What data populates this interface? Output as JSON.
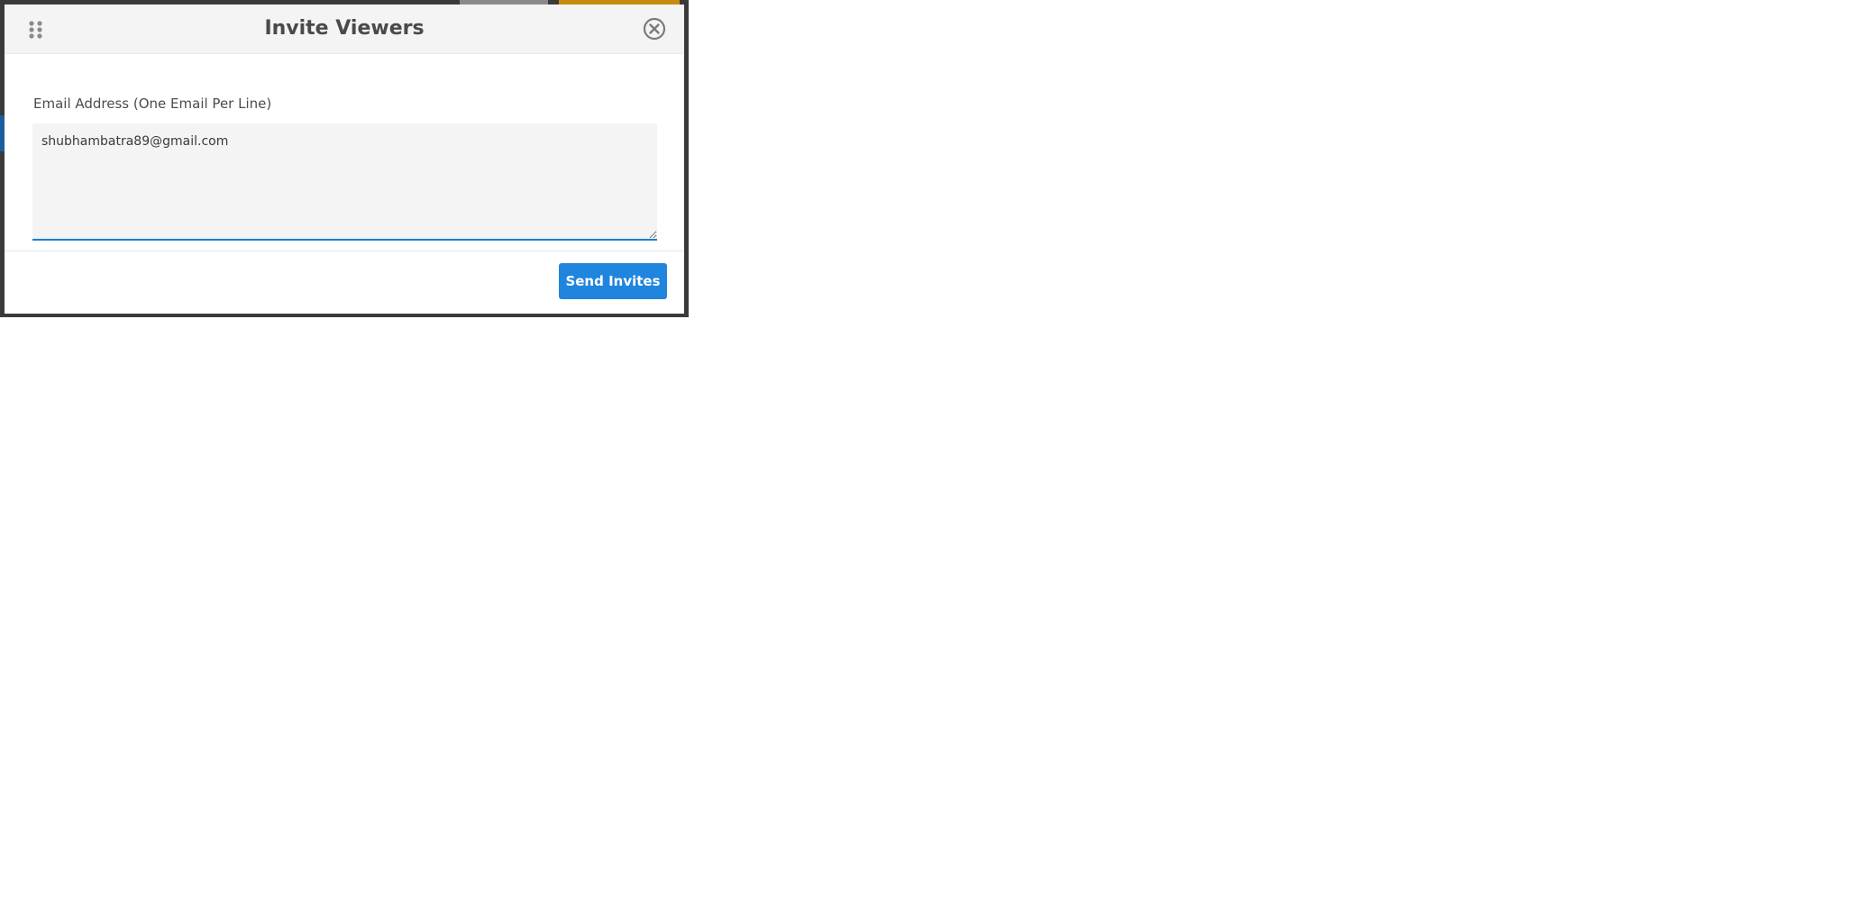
{
  "modal": {
    "title": "Invite Viewers",
    "drag_icon": "drag-handle-icon",
    "close_icon": "close-circle-icon"
  },
  "form": {
    "email_label": "Email Address (One Email Per Line)",
    "email_value": "shubhambatra89@gmail.com"
  },
  "footer": {
    "send_label": "Send Invites"
  },
  "colors": {
    "primary": "#1f85de",
    "header_bg": "#f4f4f4",
    "textarea_bg": "#f4f4f4",
    "focus_border": "#1f7bd8"
  }
}
